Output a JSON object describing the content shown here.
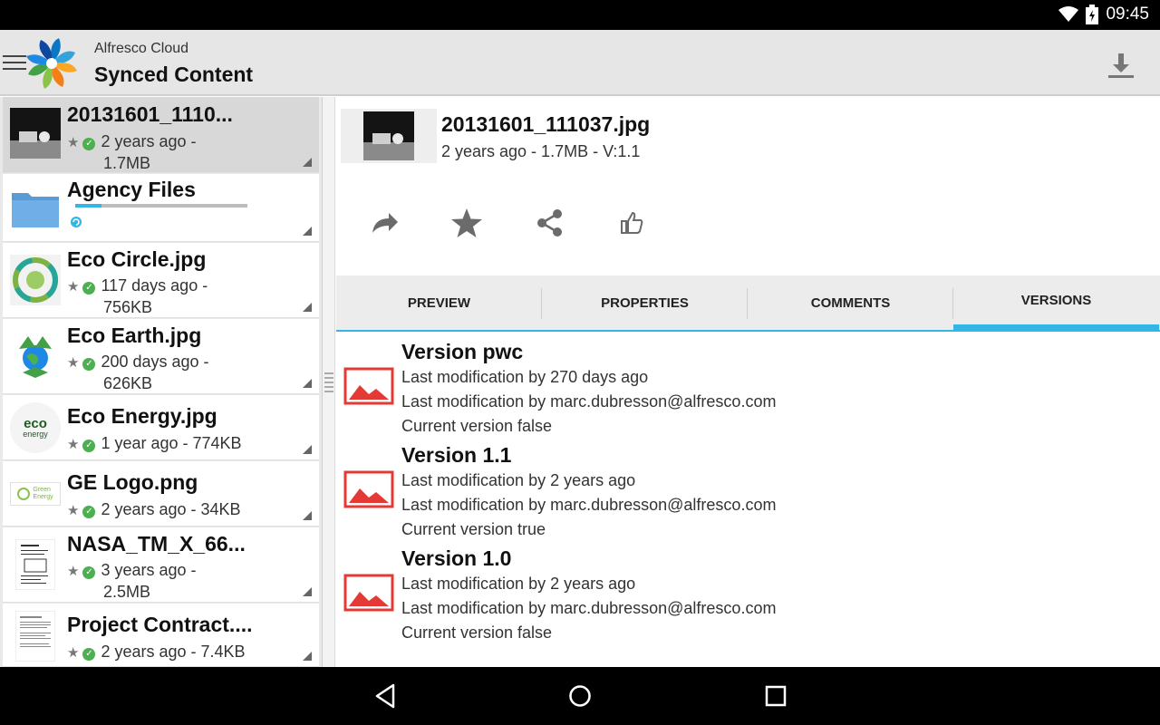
{
  "status": {
    "time": "09:45"
  },
  "actionbar": {
    "app_name": "Alfresco Cloud",
    "title": "Synced Content"
  },
  "files": [
    {
      "name": "20131601_1110...",
      "meta_line1": "2 years ago -",
      "meta_line2": "1.7MB",
      "selected": true
    },
    {
      "name": "Agency Files",
      "progress": 0.15,
      "type": "folder"
    },
    {
      "name": "Eco Circle.jpg",
      "meta_line1": "117 days ago -",
      "meta_line2": "756KB"
    },
    {
      "name": "Eco Earth.jpg",
      "meta_line1": "200 days ago -",
      "meta_line2": "626KB"
    },
    {
      "name": "Eco Energy.jpg",
      "meta_line1": "1 year ago - 774KB"
    },
    {
      "name": "GE Logo.png",
      "meta_line1": "2 years ago - 34KB"
    },
    {
      "name": "NASA_TM_X_66...",
      "meta_line1": "3 years ago -",
      "meta_line2": "2.5MB"
    },
    {
      "name": "Project Contract....",
      "meta_line1": "2 years ago - 7.4KB"
    }
  ],
  "thumb_text": {
    "eco_energy": "eco",
    "eco_energy_sub": "energy",
    "ge_logo_1": "Green",
    "ge_logo_2": "Energy"
  },
  "detail": {
    "title": "20131601_111037.jpg",
    "meta": "2 years ago - 1.7MB - V:1.1",
    "tabs": [
      "PREVIEW",
      "PROPERTIES",
      "COMMENTS",
      "VERSIONS"
    ],
    "active_tab": "VERSIONS",
    "versions": [
      {
        "title": "Version pwc",
        "line1": "Last modification by 270 days ago",
        "line2": "Last modification by marc.dubresson@alfresco.com",
        "line3": "Current version false"
      },
      {
        "title": "Version 1.1",
        "line1": "Last modification by 2 years ago",
        "line2": "Last modification by marc.dubresson@alfresco.com",
        "line3": "Current version true"
      },
      {
        "title": "Version 1.0",
        "line1": "Last modification by 2 years ago",
        "line2": "Last modification by marc.dubresson@alfresco.com",
        "line3": "Current version false"
      }
    ]
  },
  "colors": {
    "accent": "#33b5e5",
    "ok": "#4caf50",
    "version_icon": "#e53935"
  }
}
